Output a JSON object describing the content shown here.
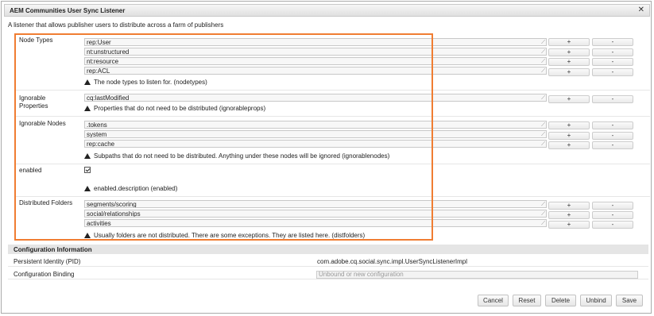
{
  "dialog": {
    "title": "AEM Communities User Sync Listener",
    "description": "A listener that allows publisher users to distribute across a farm of publishers"
  },
  "fields": {
    "node_types": {
      "label": "Node Types",
      "values": [
        "rep:User",
        "nt:unstructured",
        "nt:resource",
        "rep:ACL"
      ],
      "hint": "The node types to listen for. (nodetypes)"
    },
    "ignorable_properties": {
      "label_line1": "Ignorable",
      "label_line2": "Properties",
      "values": [
        "cq:lastModified"
      ],
      "hint": "Properties that do not need to be distributed (ignorableprops)"
    },
    "ignorable_nodes": {
      "label": "Ignorable Nodes",
      "values": [
        ".tokens",
        "system",
        "rep:cache"
      ],
      "hint": "Subpaths that do not need to be distributed. Anything under these nodes will be ignored (ignorablenodes)"
    },
    "enabled": {
      "label": "enabled",
      "checked": true,
      "hint": "enabled.description (enabled)"
    },
    "distributed_folders": {
      "label": "Distributed Folders",
      "values": [
        "segments/scoring",
        "social/relationships",
        "activities"
      ],
      "hint": "Usually folders are not distributed. There are some exceptions. They are listed here. (distfolders)"
    },
    "add_label": "+",
    "remove_label": "-"
  },
  "config_info": {
    "heading": "Configuration Information",
    "pid_label": "Persistent Identity (PID)",
    "pid_value": "com.adobe.cq.social.sync.impl.UserSyncListenerImpl",
    "binding_label": "Configuration Binding",
    "binding_placeholder": "Unbound or new configuration"
  },
  "footer": {
    "cancel": "Cancel",
    "reset": "Reset",
    "delete": "Delete",
    "unbind": "Unbind",
    "save": "Save"
  },
  "colors": {
    "highlight_border": "#f07d32"
  }
}
